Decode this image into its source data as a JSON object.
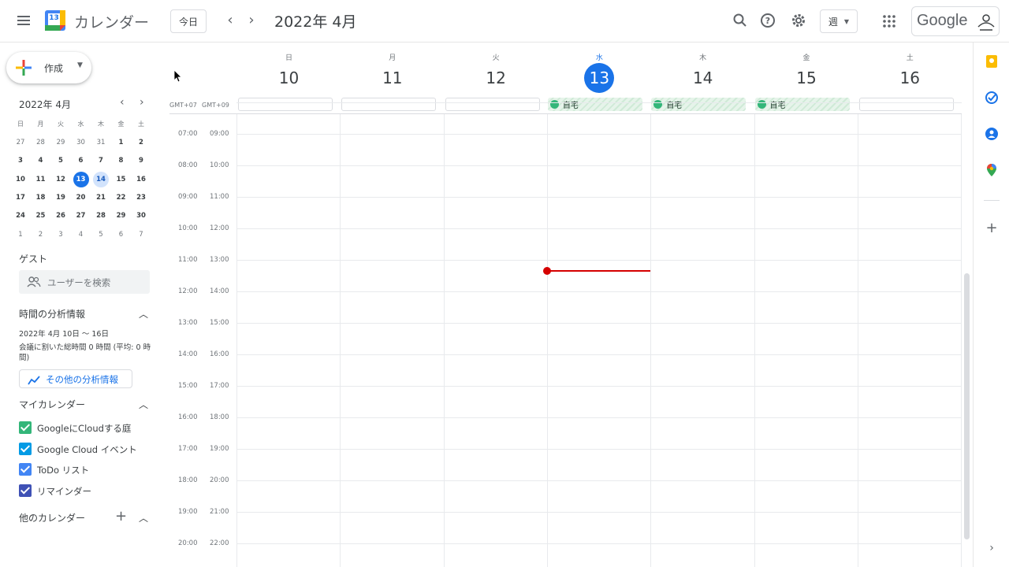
{
  "header": {
    "app_name": "カレンダー",
    "logo_day": "13",
    "today_label": "今日",
    "prev_label": "‹",
    "next_label": "›",
    "month_title": "2022年 4月",
    "view_label": "週",
    "account_label": "Google"
  },
  "sidebar": {
    "create_label": "作成",
    "mini_calendar": {
      "title": "2022年 4月",
      "weekdays": [
        "日",
        "月",
        "火",
        "水",
        "木",
        "金",
        "土"
      ],
      "weeks": [
        [
          "27",
          "28",
          "29",
          "30",
          "31",
          "1",
          "2"
        ],
        [
          "3",
          "4",
          "5",
          "6",
          "7",
          "8",
          "9"
        ],
        [
          "10",
          "11",
          "12",
          "13",
          "14",
          "15",
          "16"
        ],
        [
          "17",
          "18",
          "19",
          "20",
          "21",
          "22",
          "23"
        ],
        [
          "24",
          "25",
          "26",
          "27",
          "28",
          "29",
          "30"
        ],
        [
          "1",
          "2",
          "3",
          "4",
          "5",
          "6",
          "7"
        ]
      ],
      "today": "13",
      "selected": "14"
    },
    "guests": {
      "label": "ゲスト",
      "search_placeholder": "ユーザーを検索"
    },
    "insights": {
      "label": "時間の分析情報",
      "range": "2022年 4月 10日 〜 16日",
      "description": "会議に割いた総時間 0 時間 (平均: 0 時間)",
      "more_label": "その他の分析情報"
    },
    "my_calendars": {
      "label": "マイカレンダー",
      "items": [
        {
          "label": "GoogleにCloudする庭",
          "color": "#33b679"
        },
        {
          "label": "Google Cloud イベント",
          "color": "#039be5"
        },
        {
          "label": "ToDo リスト",
          "color": "#4285f4"
        },
        {
          "label": "リマインダー",
          "color": "#3f51b5"
        }
      ]
    },
    "other_calendars": {
      "label": "他のカレンダー"
    }
  },
  "week": {
    "days": [
      {
        "dow": "日",
        "date": "10"
      },
      {
        "dow": "月",
        "date": "11"
      },
      {
        "dow": "火",
        "date": "12"
      },
      {
        "dow": "水",
        "date": "13"
      },
      {
        "dow": "木",
        "date": "14"
      },
      {
        "dow": "金",
        "date": "15"
      },
      {
        "dow": "土",
        "date": "16"
      }
    ],
    "today_index": 3,
    "timezones": [
      "GMT+07",
      "GMT+09"
    ],
    "all_day_events": [
      {
        "day_index": 3,
        "label": "自宅"
      },
      {
        "day_index": 4,
        "label": "自宅"
      },
      {
        "day_index": 5,
        "label": "自宅"
      }
    ],
    "hours_primary": [
      "07:00",
      "08:00",
      "09:00",
      "10:00",
      "11:00",
      "12:00",
      "13:00",
      "14:00",
      "15:00",
      "16:00",
      "17:00",
      "18:00",
      "19:00",
      "20:00"
    ],
    "hours_secondary": [
      "09:00",
      "10:00",
      "11:00",
      "12:00",
      "13:00",
      "14:00",
      "15:00",
      "16:00",
      "17:00",
      "18:00",
      "19:00",
      "20:00",
      "21:00",
      "22:00"
    ]
  },
  "colors": {
    "accent": "#1a73e8",
    "now_line": "#d50000",
    "home_event": "#33b679"
  }
}
